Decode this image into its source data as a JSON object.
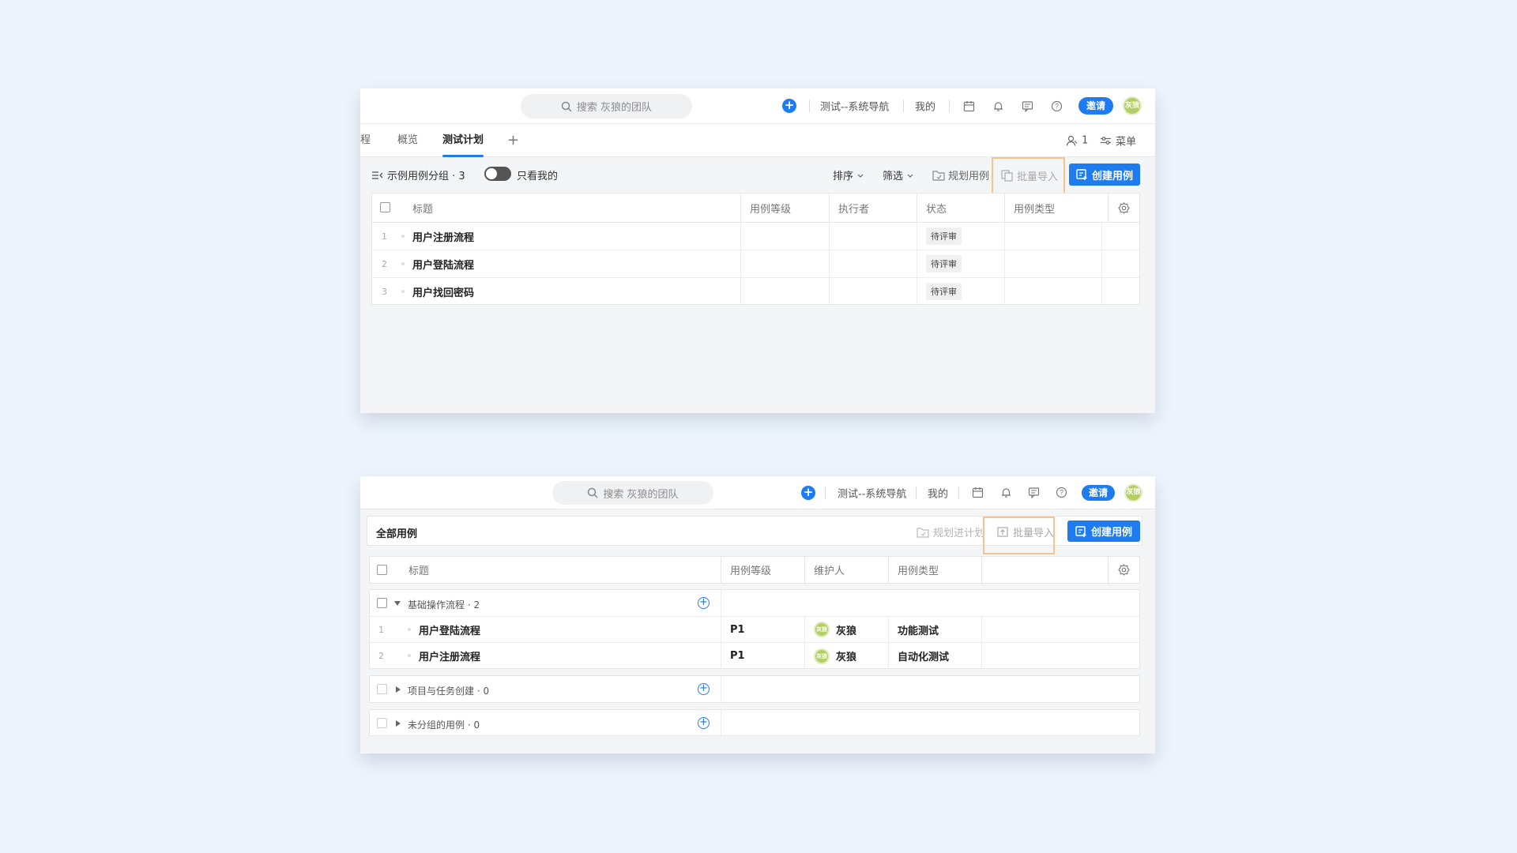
{
  "topbar": {
    "search_placeholder": "搜索 灰狼的团队",
    "project_name": "测试--系统导航",
    "mine": "我的",
    "invite": "邀请",
    "avatar_text": "灰狼"
  },
  "panel1": {
    "tabs": [
      "程",
      "概览",
      "测试计划"
    ],
    "member_count": "1",
    "menu": "菜单",
    "group_label": "示例用例分组 · 3",
    "only_mine": "只看我的",
    "sort": "排序",
    "filter": "筛选",
    "plan_case": "规划用例",
    "batch_import": "批量导入",
    "create_case": "创建用例",
    "columns": [
      "标题",
      "用例等级",
      "执行者",
      "状态",
      "用例类型"
    ],
    "rows": [
      {
        "num": "1",
        "title": "用户注册流程",
        "status": "待评审"
      },
      {
        "num": "2",
        "title": "用户登陆流程",
        "status": "待评审"
      },
      {
        "num": "3",
        "title": "用户找回密码",
        "status": "待评审"
      }
    ]
  },
  "panel2": {
    "title": "全部用例",
    "plan_to": "规划进计划",
    "batch_import": "批量导入",
    "create_case": "创建用例",
    "columns": [
      "标题",
      "用例等级",
      "维护人",
      "用例类型"
    ],
    "groups": [
      {
        "name": "基础操作流程 · 2",
        "expanded": true
      },
      {
        "name": "项目与任务创建 · 0",
        "expanded": false
      },
      {
        "name": "未分组的用例 · 0",
        "expanded": false
      }
    ],
    "rows": [
      {
        "num": "1",
        "title": "用户登陆流程",
        "level": "P1",
        "owner": "灰狼",
        "owner_avatar": "灰狼",
        "type": "功能测试"
      },
      {
        "num": "2",
        "title": "用户注册流程",
        "level": "P1",
        "owner": "灰狼",
        "owner_avatar": "灰狼",
        "type": "自动化测试"
      }
    ]
  },
  "colors": {
    "primary": "#1e7bf0",
    "highlight": "#f6c28f",
    "avatar": "#b3cf64"
  }
}
